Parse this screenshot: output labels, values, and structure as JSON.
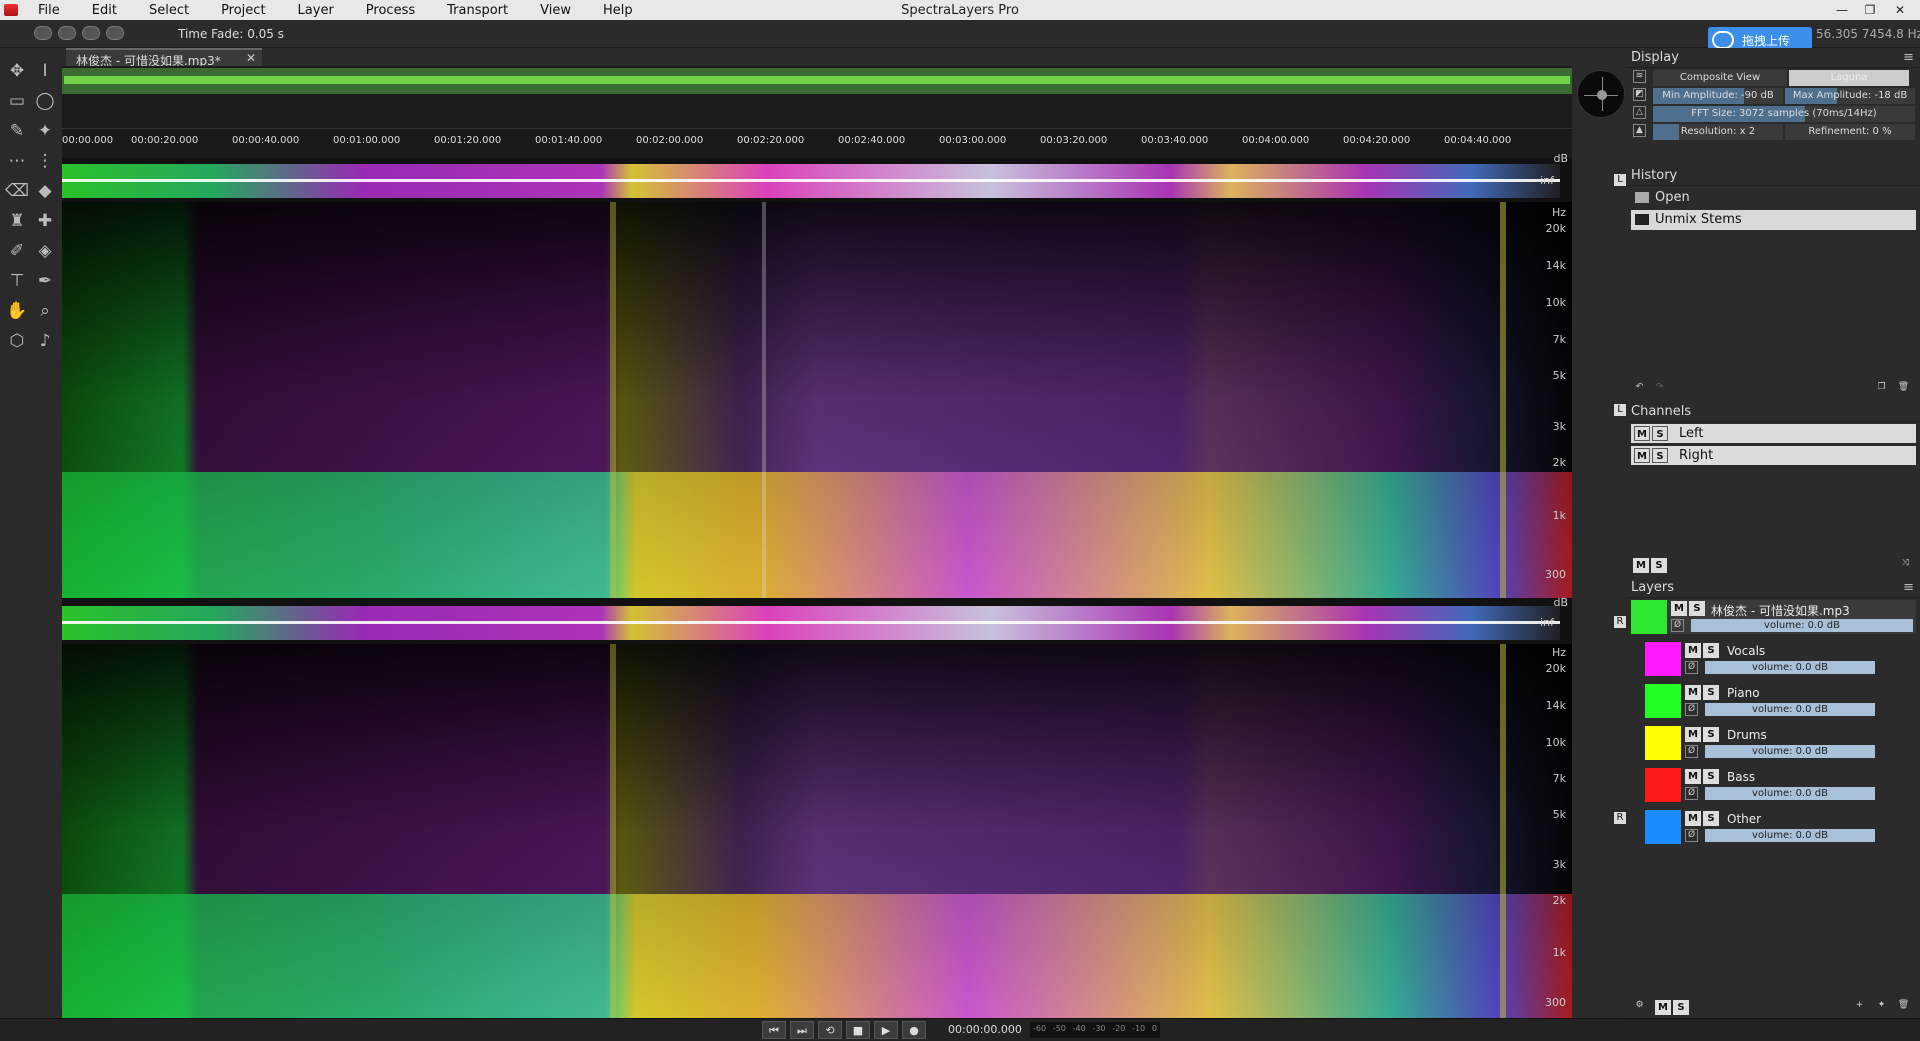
{
  "app": {
    "title": "SpectraLayers Pro"
  },
  "menu": [
    "File",
    "Edit",
    "Select",
    "Project",
    "Layer",
    "Process",
    "Transport",
    "View",
    "Help"
  ],
  "window_controls": {
    "minimize": "—",
    "restore": "❐",
    "close": "✕"
  },
  "options_bar": {
    "time_fade": "Time Fade: 0.05 s"
  },
  "overlay": {
    "cloud_label": "拖拽上传",
    "coords": "56.305  7454.8 Hz"
  },
  "file_tab": {
    "name": "林俊杰 - 可惜没如果.mp3*",
    "close": "✕"
  },
  "timeline": {
    "ticks": [
      "00:00.000",
      "00:00:20.000",
      "00:00:40.000",
      "00:01:00.000",
      "00:01:20.000",
      "00:01:40.000",
      "00:02:00.000",
      "00:02:20.000",
      "00:02:40.000",
      "00:03:00.000",
      "00:03:20.000",
      "00:03:40.000",
      "00:04:00.000",
      "00:04:20.000",
      "00:04:40.000"
    ]
  },
  "channels_view": {
    "db_unit": "dB",
    "hz_unit": "Hz",
    "wave_label": "-inf",
    "left_badge": "L",
    "right_badge": "R",
    "freq_labels": [
      "20k",
      "14k",
      "10k",
      "7k",
      "5k",
      "3k",
      "2k",
      "1k",
      "300"
    ]
  },
  "display": {
    "header": "Display",
    "composite_view": "Composite View",
    "colormap": "Laguna",
    "min_amplitude": "Min Amplitude: -90 dB",
    "max_amplitude": "Max Amplitude: -18 dB",
    "fft_size": "FFT Size: 3072 samples (70ms/14Hz)",
    "resolution": "Resolution: x 2",
    "refinement": "Refinement: 0 %"
  },
  "history": {
    "header": "History",
    "items": [
      "Open",
      "Unmix Stems"
    ],
    "selected": 1
  },
  "channels": {
    "header": "Channels",
    "items": [
      "Left",
      "Right"
    ],
    "m_label": "M",
    "s_label": "S"
  },
  "layers": {
    "header": "Layers",
    "parent": {
      "name": "林俊杰 - 可惜没如果.mp3",
      "volume": "volume: 0.0 dB",
      "color": "#2ee82e"
    },
    "items": [
      {
        "name": "Vocals",
        "volume": "volume: 0.0 dB",
        "color": "#ff1aff"
      },
      {
        "name": "Piano",
        "volume": "volume: 0.0 dB",
        "color": "#22ff22"
      },
      {
        "name": "Drums",
        "volume": "volume: 0.0 dB",
        "color": "#ffff00"
      },
      {
        "name": "Bass",
        "volume": "volume: 0.0 dB",
        "color": "#ff1a1a"
      },
      {
        "name": "Other",
        "volume": "volume: 0.0 dB",
        "color": "#1a8cff"
      }
    ]
  },
  "transport": {
    "time": "00:00:00.000",
    "meter_labels": [
      "-60",
      "-50",
      "-40",
      "-30",
      "-20",
      "-10",
      "0"
    ],
    "buttons": [
      "⏮",
      "⏭",
      "⟲",
      "■",
      "▶",
      "●"
    ]
  }
}
